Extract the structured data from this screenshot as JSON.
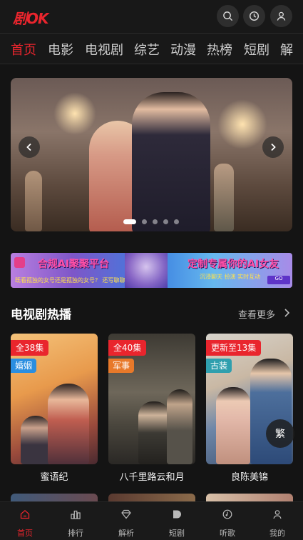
{
  "app": {
    "logo": "剧OK"
  },
  "header": {
    "search_icon": "search-icon",
    "history_icon": "history-icon",
    "user_icon": "user-icon"
  },
  "nav": {
    "tabs": [
      {
        "label": "首页",
        "active": true
      },
      {
        "label": "电影"
      },
      {
        "label": "电视剧"
      },
      {
        "label": "综艺"
      },
      {
        "label": "动漫"
      },
      {
        "label": "热榜"
      },
      {
        "label": "短剧"
      },
      {
        "label": "解"
      }
    ]
  },
  "banner": {
    "slide_count": 5,
    "active_index": 0
  },
  "ad": {
    "headline_left": "合规AI聚聚平台",
    "headline_right": "定制专属你的AI女友",
    "subtitle_left": "既看孤独的女号还是孤独的女号？ 还写聊聊",
    "subtitle_right": "沉浸聊天 扮演 实时互动",
    "button": "GO"
  },
  "section": {
    "title": "电视剧热播",
    "more": "查看更多",
    "cards": [
      {
        "episodes": "全38集",
        "tag": "婚姻",
        "name": "蜜语纪"
      },
      {
        "episodes": "全40集",
        "tag": "军事",
        "name": "八千里路云和月"
      },
      {
        "episodes": "更新至13集",
        "tag": "古装",
        "name": "良陈美锦"
      }
    ]
  },
  "float_button": {
    "label": "繁"
  },
  "bottom_nav": {
    "items": [
      {
        "label": "首页",
        "icon": "home-icon",
        "active": true
      },
      {
        "label": "排行",
        "icon": "ranking-icon"
      },
      {
        "label": "解析",
        "icon": "diamond-icon"
      },
      {
        "label": "短剧",
        "icon": "play-icon"
      },
      {
        "label": "听歌",
        "icon": "music-icon"
      },
      {
        "label": "我的",
        "icon": "profile-icon"
      }
    ]
  },
  "colors": {
    "accent": "#e9252d",
    "background": "#141414"
  }
}
